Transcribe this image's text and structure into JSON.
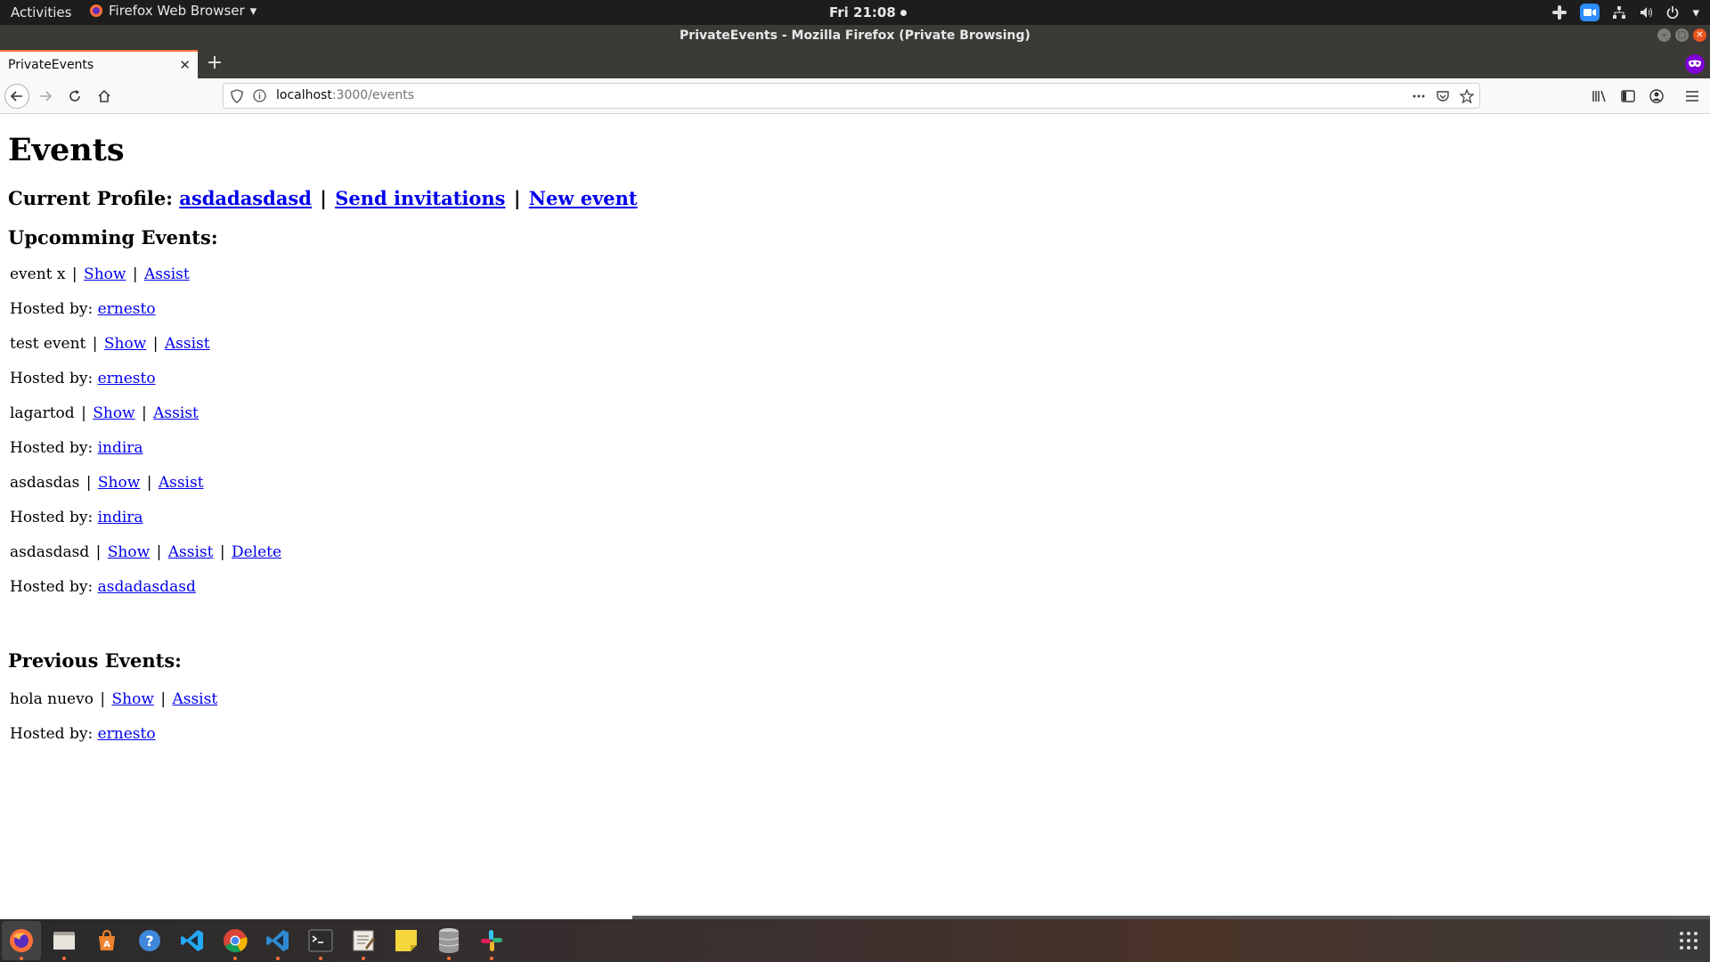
{
  "topbar": {
    "activities": "Activities",
    "app_menu": "Firefox Web Browser",
    "clock": "Fri 21:08"
  },
  "window": {
    "title": "PrivateEvents - Mozilla Firefox (Private Browsing)"
  },
  "tab": {
    "label": "PrivateEvents"
  },
  "urlbar": {
    "host": "localhost",
    "path": ":3000/events"
  },
  "page": {
    "title": "Events",
    "profile_label": "Current Profile:",
    "profile_name": "asdadasdasd",
    "send_invitations": "Send invitations",
    "new_event": "New event",
    "upcoming_heading": "Upcomming Events:",
    "previous_heading": "Previous Events:",
    "show_label": "Show",
    "assist_label": "Assist",
    "delete_label": "Delete",
    "hosted_by_label": "Hosted by:",
    "upcoming": [
      {
        "name": "event x",
        "host": "ernesto"
      },
      {
        "name": "test event",
        "host": "ernesto"
      },
      {
        "name": "lagartod",
        "host": "indira"
      },
      {
        "name": "asdasdas",
        "host": "indira"
      },
      {
        "name": "asdasdasd",
        "host": "asdadasdasd",
        "deletable": true
      }
    ],
    "previous": [
      {
        "name": "hola nuevo",
        "host": "ernesto"
      }
    ]
  },
  "dock": {
    "apps": [
      "firefox-icon",
      "files-icon",
      "software-center-icon",
      "help-icon",
      "vscode-icon",
      "chrome-icon",
      "vscode-icon-2",
      "terminal-icon",
      "text-editor-icon",
      "sticky-notes-icon",
      "database-icon",
      "slack-icon"
    ]
  },
  "colors": {
    "link": "#0000ee",
    "private_purple": "#8000d7",
    "tab_accent": "#ff7139"
  }
}
